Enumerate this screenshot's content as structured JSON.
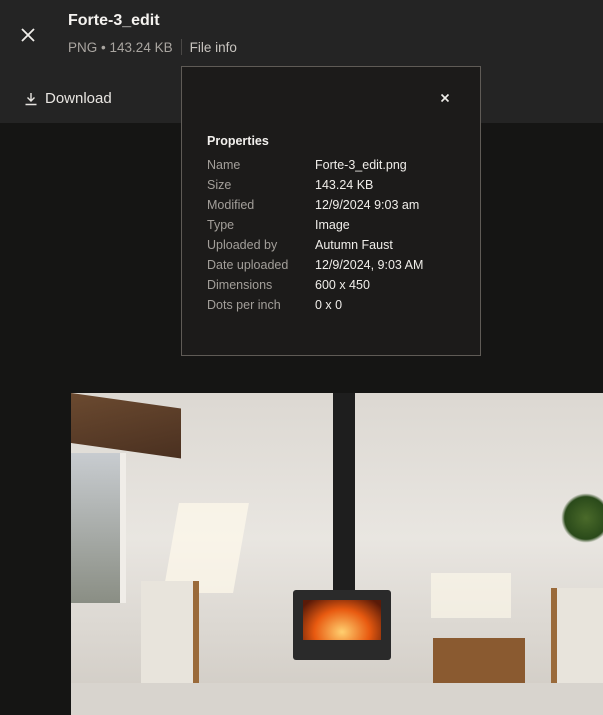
{
  "header": {
    "title": "Forte-3_edit",
    "file_type": "PNG",
    "file_size": "143.24 KB",
    "separator": "•",
    "file_info_label": "File info",
    "download_label": "Download"
  },
  "properties": {
    "title": "Properties",
    "rows": [
      {
        "key": "Name",
        "value": "Forte-3_edit.png"
      },
      {
        "key": "Size",
        "value": "143.24 KB"
      },
      {
        "key": "Modified",
        "value": "12/9/2024 9:03 am"
      },
      {
        "key": "Type",
        "value": "Image"
      },
      {
        "key": "Uploaded by",
        "value": "Autumn Faust"
      },
      {
        "key": "Date uploaded",
        "value": "12/9/2024, 9:03 AM"
      },
      {
        "key": "Dimensions",
        "value": "600 x 450"
      },
      {
        "key": "Dots per inch",
        "value": "0 x 0"
      }
    ]
  }
}
